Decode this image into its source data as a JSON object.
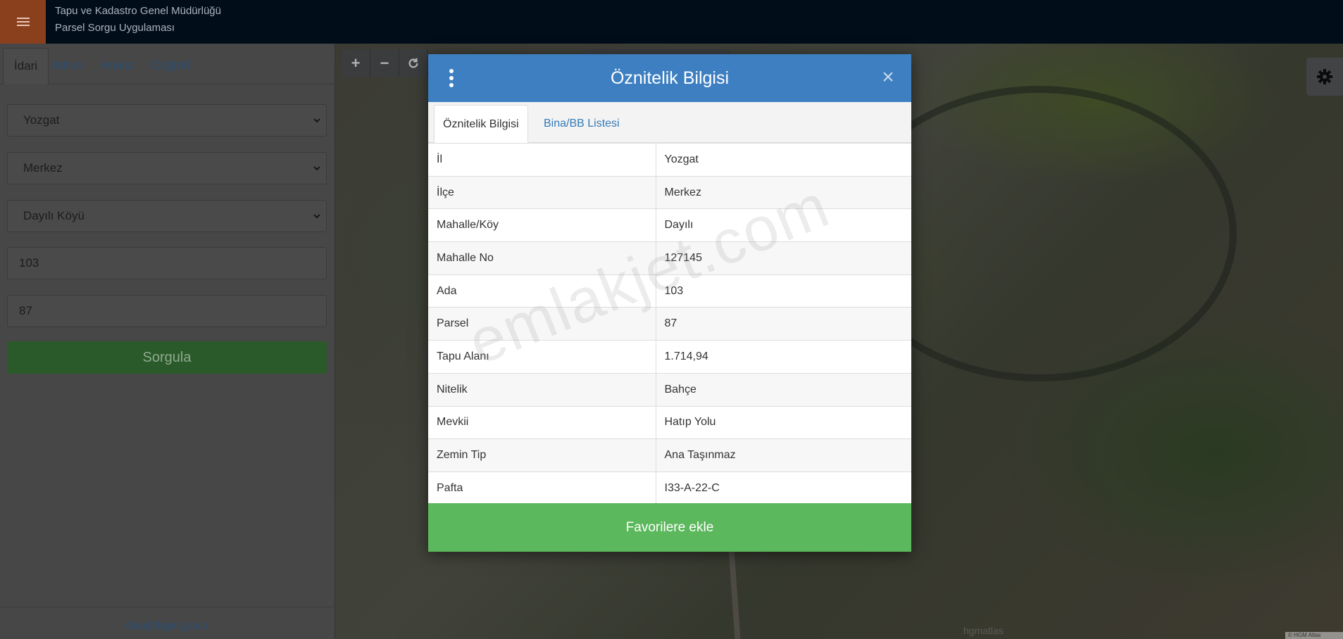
{
  "header": {
    "title_line1": "Tapu ve Kadastro Genel Müdürlüğü",
    "title_line2": "Parsel Sorgu Uygulaması"
  },
  "sidebar": {
    "tabs": [
      {
        "label": "İdari",
        "active": true
      },
      {
        "label": "Adres",
        "active": false
      },
      {
        "label": "Analiz",
        "active": false
      },
      {
        "label": "Coğrafi",
        "active": false
      }
    ],
    "province": "Yozgat",
    "district": "Merkez",
    "neighborhood": "Dayılı Köyü",
    "block": "103",
    "parcel": "87",
    "query_button": "Sorgula",
    "footer_email": "cbs@tkgm.gov.tr"
  },
  "map": {
    "toolbar": [
      {
        "icon": "plus-icon",
        "glyph": "+"
      },
      {
        "icon": "minus-icon",
        "glyph": "−"
      },
      {
        "icon": "refresh-icon",
        "glyph": ""
      }
    ],
    "watermark_text": "hgmatlas",
    "attribution": "© HGM Atlas"
  },
  "modal": {
    "title": "Öznitelik Bilgisi",
    "close_glyph": "×",
    "tabs": [
      {
        "label": "Öznitelik Bilgisi",
        "active": true
      },
      {
        "label": "Bina/BB Listesi",
        "active": false
      }
    ],
    "rows": [
      {
        "key": "İl",
        "value": "Yozgat"
      },
      {
        "key": "İlçe",
        "value": "Merkez"
      },
      {
        "key": "Mahalle/Köy",
        "value": "Dayılı"
      },
      {
        "key": "Mahalle No",
        "value": "127145"
      },
      {
        "key": "Ada",
        "value": "103"
      },
      {
        "key": "Parsel",
        "value": "87"
      },
      {
        "key": "Tapu Alanı",
        "value": "1.714,94"
      },
      {
        "key": "Nitelik",
        "value": "Bahçe"
      },
      {
        "key": "Mevkii",
        "value": "Hatıp Yolu"
      },
      {
        "key": "Zemin Tip",
        "value": "Ana Taşınmaz"
      },
      {
        "key": "Pafta",
        "value": "I33-A-22-C"
      }
    ],
    "favorite_button": "Favorilere ekle"
  },
  "watermark": "emlakjet.com",
  "colors": {
    "header_bg": "#020d1a",
    "menu_bg": "#8a3f1d",
    "modal_header": "#3d7fc1",
    "favorite_btn": "#5cb85c",
    "query_btn": "#2a5a2a",
    "link": "#337ab7"
  }
}
